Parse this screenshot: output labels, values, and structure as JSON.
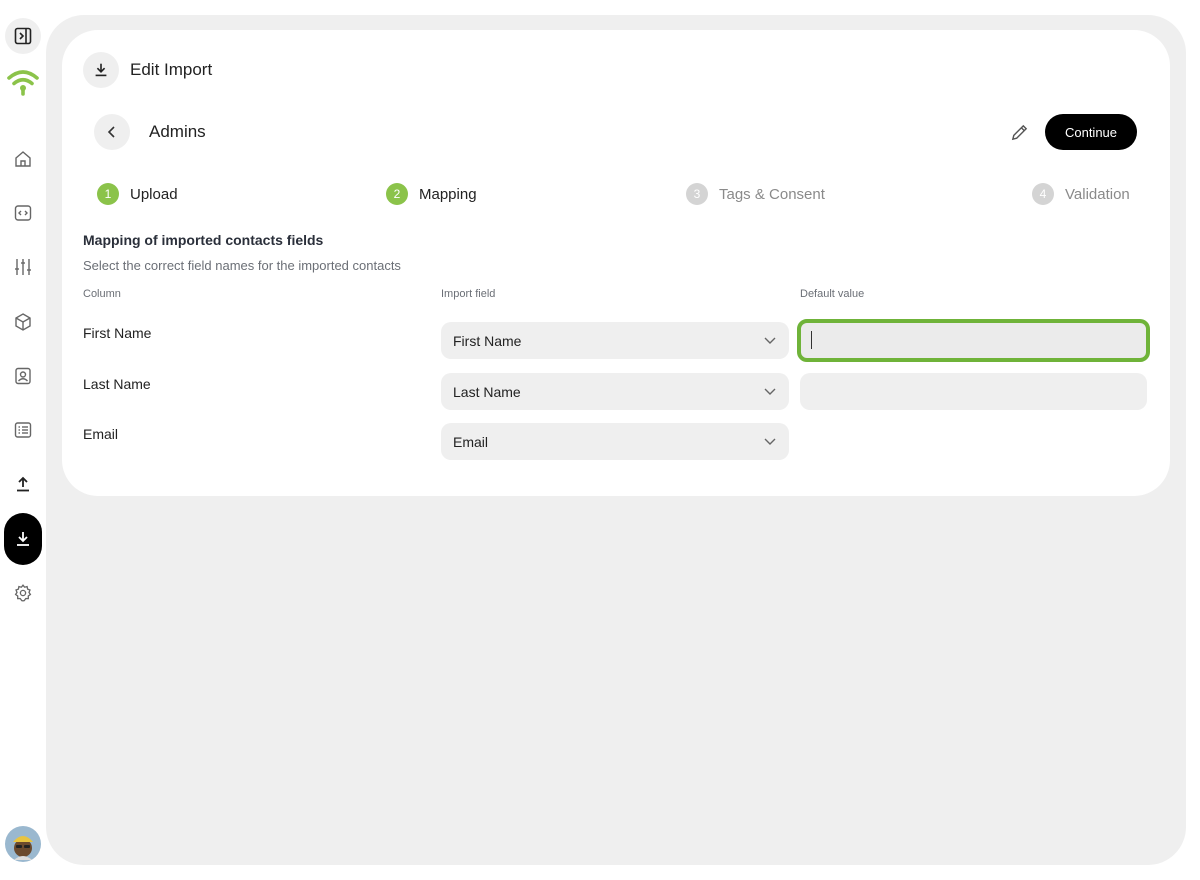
{
  "header": {
    "title": "Edit Import"
  },
  "subheader": {
    "title": "Admins",
    "continue_label": "Continue"
  },
  "steps": [
    {
      "num": "1",
      "label": "Upload",
      "state": "done"
    },
    {
      "num": "2",
      "label": "Mapping",
      "state": "done"
    },
    {
      "num": "3",
      "label": "Tags & Consent",
      "state": "todo"
    },
    {
      "num": "4",
      "label": "Validation",
      "state": "todo"
    }
  ],
  "mapping": {
    "title": "Mapping of imported contacts fields",
    "subtitle": "Select the correct field names for the imported contacts",
    "columns": {
      "column": "Column",
      "import_field": "Import field",
      "default_value": "Default value"
    },
    "rows": [
      {
        "column": "First Name",
        "import_field": "First Name",
        "default_value": ""
      },
      {
        "column": "Last Name",
        "import_field": "Last Name",
        "default_value": ""
      },
      {
        "column": "Email",
        "import_field": "Email"
      }
    ]
  },
  "sidebar": {
    "items": [
      "toggle-sidebar-icon",
      "home-icon",
      "code-icon",
      "sliders-icon",
      "box-icon",
      "contacts-icon",
      "list-icon",
      "upload-icon",
      "download-icon",
      "gear-icon"
    ],
    "active": "download-icon"
  },
  "colors": {
    "accent": "#8bc34a",
    "focus": "#6fb339",
    "primary_button": "#000000",
    "canvas": "#efefef"
  }
}
